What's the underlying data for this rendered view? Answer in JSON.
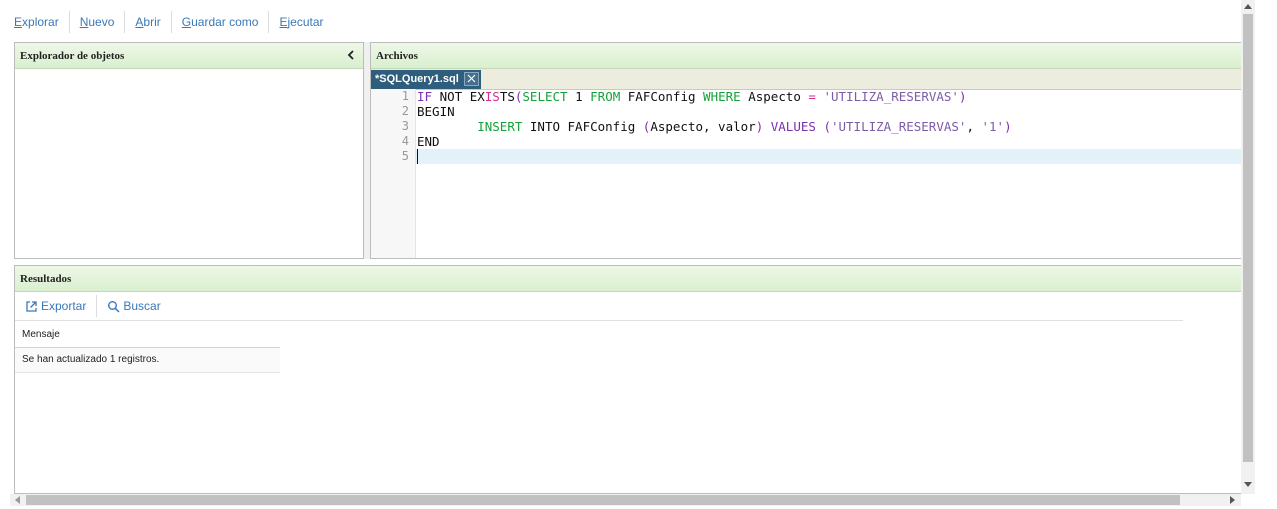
{
  "toolbar": {
    "items": [
      {
        "key": "E",
        "rest": "xplorar"
      },
      {
        "key": "N",
        "rest": "uevo"
      },
      {
        "key": "A",
        "rest": "brir"
      },
      {
        "key": "G",
        "rest": "uardar como"
      },
      {
        "key": "E",
        "rest": "jecutar"
      }
    ]
  },
  "explorer": {
    "title": "Explorador de objetos"
  },
  "files": {
    "title": "Archivos",
    "tab_label": "*SQLQuery1.sql",
    "line_numbers": [
      "1",
      "2",
      "3",
      "4",
      "5"
    ],
    "code": {
      "l1_if": "IF",
      "l1_not": " NOT EX",
      "l1_is": "IS",
      "l1_ts": "TS",
      "l1_paren_open": "(",
      "l1_select": "SELECT",
      "l1_one": " 1 ",
      "l1_from": "FROM",
      "l1_table": " FAFConfig ",
      "l1_where": "WHERE",
      "l1_col": " Aspecto ",
      "l1_eq": "=",
      "l1_space": " ",
      "l1_str": "'UTILIZA_RESERVAS'",
      "l1_paren_close": ")",
      "l2": "BEGIN",
      "l3_indent": "        ",
      "l3_insert": "INSERT",
      "l3_into": " INTO FAFConfig ",
      "l3_po": "(",
      "l3_cols": "Aspecto, valor",
      "l3_pc": ")",
      "l3_sp": " ",
      "l3_values": "VALUES",
      "l3_sp2": " ",
      "l3_po2": "(",
      "l3_str1": "'UTILIZA_RESERVAS'",
      "l3_comma": ", ",
      "l3_str2": "'1'",
      "l3_pc2": ")",
      "l4": "END",
      "l5": ""
    }
  },
  "results": {
    "title": "Resultados",
    "export_label": "Exportar",
    "search_label": "Buscar",
    "grid_header": "Mensaje",
    "grid_rows": [
      "Se han actualizado 1 registros."
    ]
  },
  "colors": {
    "header_green": "#d9efcf",
    "tab_active": "#2f5d7c",
    "link": "#3a78b8"
  }
}
